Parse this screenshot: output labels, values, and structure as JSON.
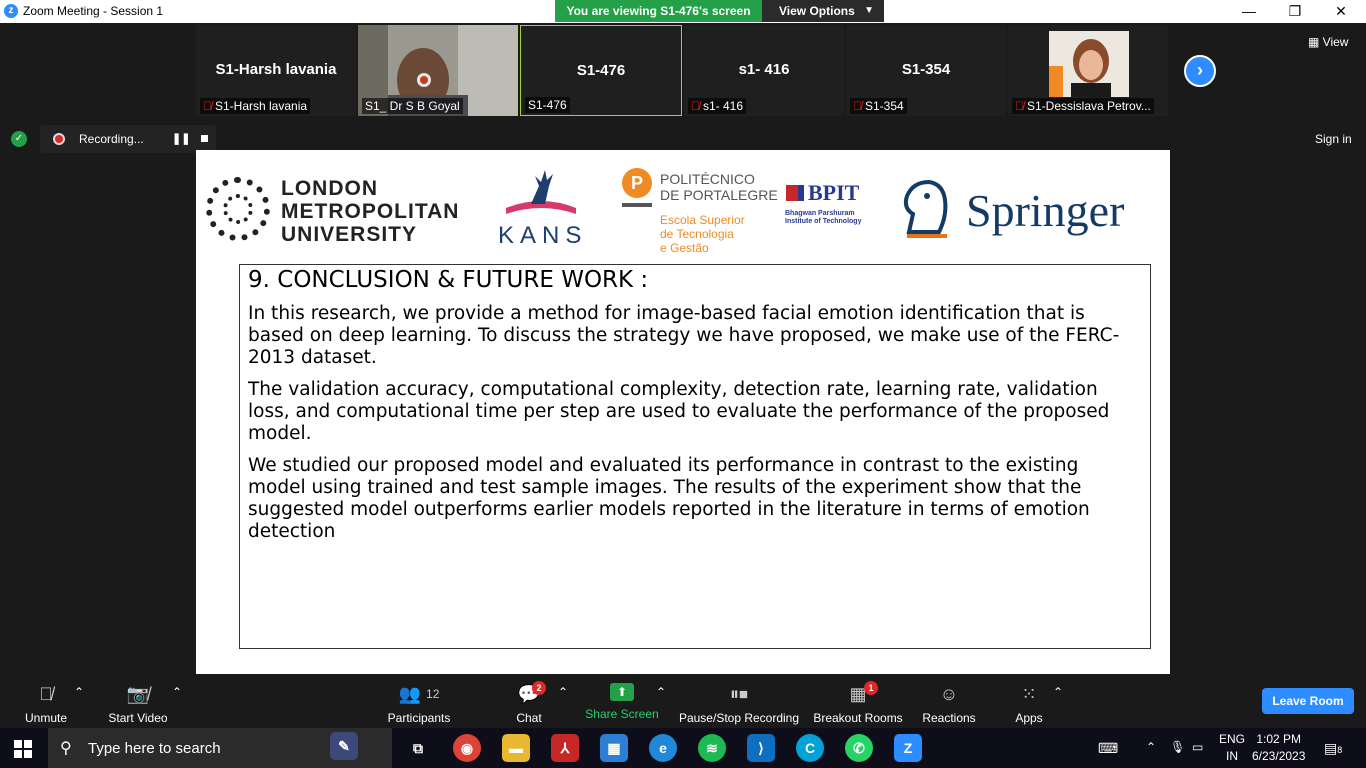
{
  "window": {
    "title": "Zoom Meeting - Session 1",
    "viewing_banner": "You are viewing S1-476's screen",
    "view_options": "View Options",
    "minimize": "—",
    "restore": "❐",
    "close": "✕"
  },
  "gallery": {
    "view_label": "View",
    "tiles": [
      {
        "center": "S1-Harsh lavania",
        "label": "S1-Harsh lavania",
        "muted": true,
        "video": false
      },
      {
        "center": "",
        "label": "S1_ Dr S B Goyal",
        "muted": false,
        "video": true
      },
      {
        "center": "S1-476",
        "label": "S1-476",
        "muted": false,
        "video": false
      },
      {
        "center": "s1- 416",
        "label": "s1- 416",
        "muted": true,
        "video": false
      },
      {
        "center": "S1-354",
        "label": "S1-354",
        "muted": true,
        "video": false
      },
      {
        "center": "",
        "label": "S1-Dessislava Petrov...",
        "muted": true,
        "video": true
      }
    ]
  },
  "recording": {
    "label": "Recording...",
    "sign_in": "Sign in"
  },
  "slide": {
    "logos": {
      "lmu": "LONDON\nMETROPOLITAN\nUNIVERSITY",
      "kans": "KANS",
      "pp_title": "POLITÉCNICO\nDE PORTALEGRE",
      "pp_sub": "Escola Superior\nde Tecnologia\ne Gestão",
      "pp_initial": "P",
      "bpit": "BPIT",
      "bpit_sub": "Bhagwan Parshuram\nInstitute of Technology",
      "springer": "Springer"
    },
    "heading": "9. CONCLUSION & FUTURE WORK :",
    "paragraphs": [
      "In this research, we provide a method for image-based facial emotion identification that is based on deep learning. To discuss the strategy we have proposed, we make use of the FERC-2013 dataset.",
      "The validation accuracy, computational complexity, detection rate, learning rate, validation loss, and computational time per step are used to evaluate the performance of the proposed model.",
      "We studied our proposed model and evaluated its performance in contrast to the existing model using trained and test sample images. The results of the experiment show that the suggested model outperforms earlier models reported in the literature in terms of emotion detection"
    ]
  },
  "toolbar": {
    "unmute": "Unmute",
    "start_video": "Start Video",
    "participants": "Participants",
    "participants_count": "12",
    "chat": "Chat",
    "chat_badge": "2",
    "share_screen": "Share Screen",
    "pause_stop_recording": "Pause/Stop Recording",
    "breakout_rooms": "Breakout Rooms",
    "breakout_badge": "1",
    "reactions": "Reactions",
    "apps": "Apps",
    "leave_room": "Leave Room"
  },
  "taskbar": {
    "search_placeholder": "Type here to search",
    "lang_top": "ENG",
    "lang_bottom": "IN",
    "time": "1:02 PM",
    "date": "6/23/2023",
    "notification_count": "8"
  },
  "colors": {
    "zoom_blue": "#2d8cff",
    "banner_green": "#24a148",
    "mute_red": "#e02828",
    "active_tile_border": "#9cd33b"
  }
}
